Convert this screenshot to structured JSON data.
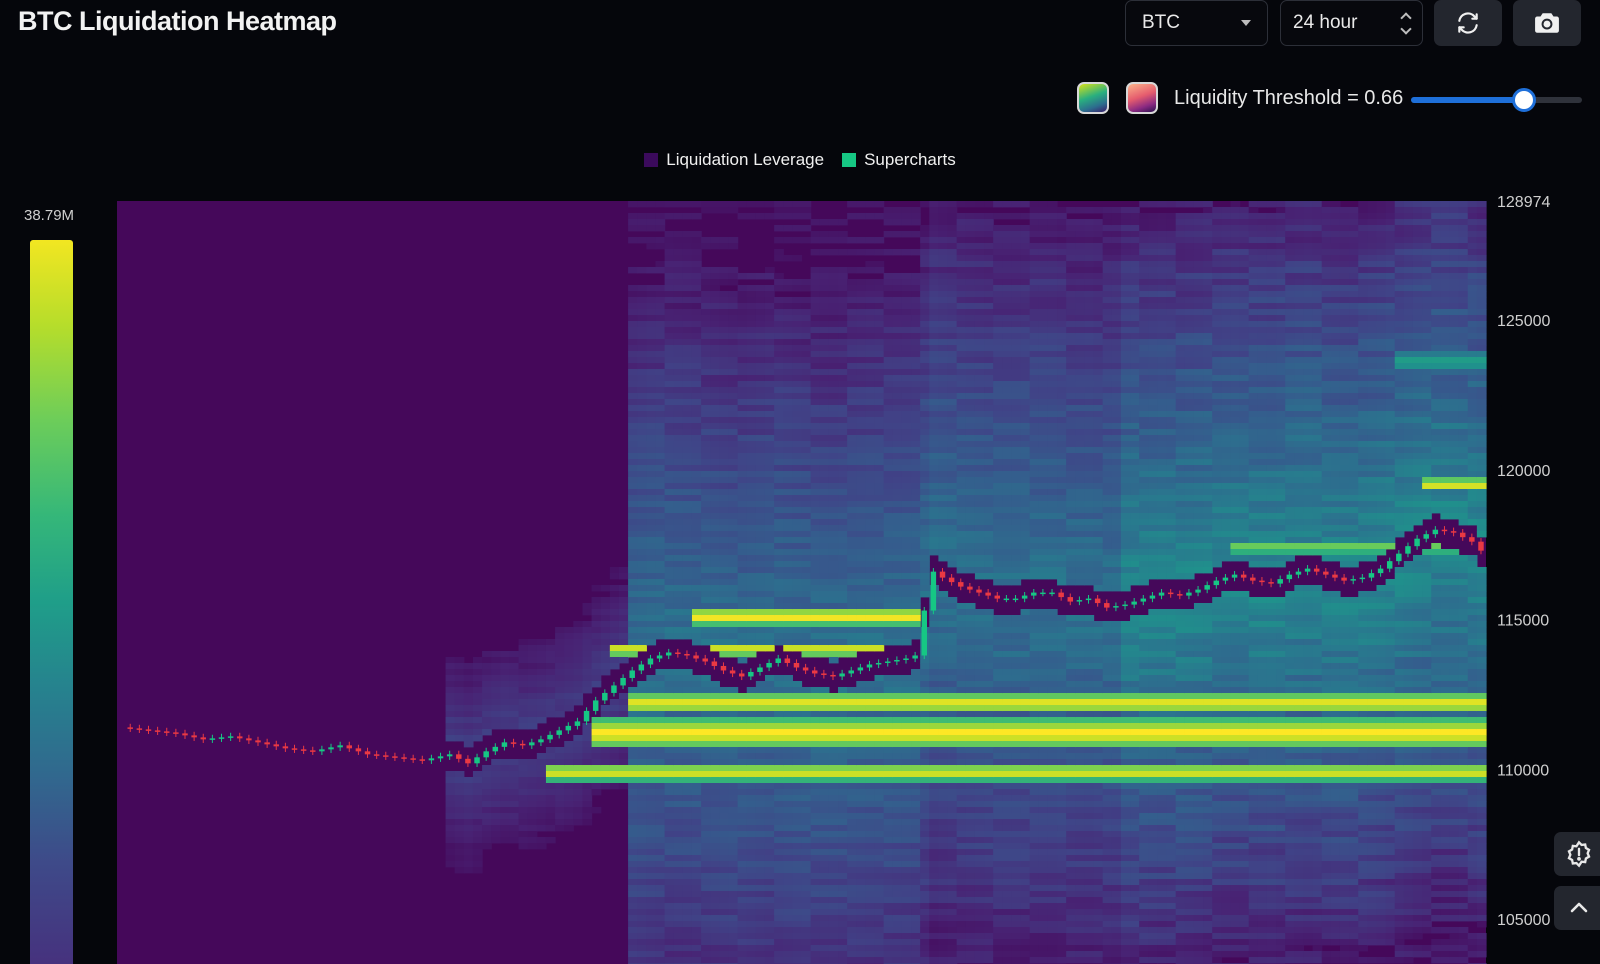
{
  "header": {
    "title": "BTC Liquidation Heatmap",
    "coin_select": {
      "value": "BTC"
    },
    "time_select": {
      "value": "24 hour"
    }
  },
  "controls": {
    "threshold_label": "Liquidity Threshold = 0.66",
    "threshold_value": 0.66,
    "threshold_range": [
      0,
      1
    ],
    "palettes": [
      "viridis",
      "magma"
    ]
  },
  "legend": [
    {
      "label": "Liquidation Leverage",
      "color": "#3b0a5c"
    },
    {
      "label": "Supercharts",
      "color": "#16c784"
    }
  ],
  "colorbar": {
    "max_label": "38.79M"
  },
  "colors": {
    "background": "#05060b",
    "candle_up": "#16c784",
    "candle_down": "#ea3943",
    "accent": "#1e6fd9"
  },
  "chart_data": {
    "type": "heatmap",
    "title": "BTC Liquidation Heatmap",
    "xlabel": "",
    "ylabel": "",
    "ylim": [
      103500,
      128974
    ],
    "y_ticks": [
      {
        "value": 128974,
        "label": "128974"
      },
      {
        "value": 125000,
        "label": "125000"
      },
      {
        "value": 120000,
        "label": "120000"
      },
      {
        "value": 115000,
        "label": "115000"
      },
      {
        "value": 110000,
        "label": "110000"
      },
      {
        "value": 105000,
        "label": "105000"
      }
    ],
    "colorbar_max": "38.79M",
    "price_series": [
      [
        0,
        111400
      ],
      [
        3,
        111300
      ],
      [
        6,
        111200
      ],
      [
        9,
        111000
      ],
      [
        12,
        111100
      ],
      [
        15,
        110900
      ],
      [
        18,
        110700
      ],
      [
        21,
        110600
      ],
      [
        24,
        110800
      ],
      [
        27,
        110500
      ],
      [
        30,
        110400
      ],
      [
        33,
        110300
      ],
      [
        36,
        110500
      ],
      [
        38,
        110200
      ],
      [
        40,
        110600
      ],
      [
        42,
        110900
      ],
      [
        44,
        110800
      ],
      [
        46,
        111000
      ],
      [
        48,
        111300
      ],
      [
        50,
        111600
      ],
      [
        52,
        112300
      ],
      [
        54,
        112800
      ],
      [
        56,
        113300
      ],
      [
        58,
        113700
      ],
      [
        60,
        113900
      ],
      [
        62,
        113800
      ],
      [
        64,
        113600
      ],
      [
        66,
        113300
      ],
      [
        68,
        113100
      ],
      [
        70,
        113400
      ],
      [
        72,
        113700
      ],
      [
        74,
        113400
      ],
      [
        76,
        113200
      ],
      [
        78,
        113100
      ],
      [
        80,
        113300
      ],
      [
        82,
        113500
      ],
      [
        84,
        113600
      ],
      [
        86,
        113700
      ],
      [
        87,
        113800
      ],
      [
        88,
        115300
      ],
      [
        89,
        116600
      ],
      [
        90,
        116400
      ],
      [
        92,
        116100
      ],
      [
        94,
        115900
      ],
      [
        96,
        115700
      ],
      [
        98,
        115700
      ],
      [
        100,
        115900
      ],
      [
        102,
        115900
      ],
      [
        104,
        115600
      ],
      [
        106,
        115700
      ],
      [
        108,
        115400
      ],
      [
        110,
        115500
      ],
      [
        112,
        115700
      ],
      [
        114,
        115900
      ],
      [
        116,
        115800
      ],
      [
        118,
        116000
      ],
      [
        120,
        116300
      ],
      [
        122,
        116500
      ],
      [
        124,
        116300
      ],
      [
        126,
        116200
      ],
      [
        128,
        116500
      ],
      [
        130,
        116700
      ],
      [
        132,
        116500
      ],
      [
        134,
        116300
      ],
      [
        136,
        116400
      ],
      [
        138,
        116700
      ],
      [
        140,
        117200
      ],
      [
        142,
        117700
      ],
      [
        144,
        118000
      ],
      [
        146,
        117900
      ],
      [
        148,
        117600
      ],
      [
        149,
        117300
      ]
    ],
    "x_range": [
      0,
      149
    ]
  }
}
